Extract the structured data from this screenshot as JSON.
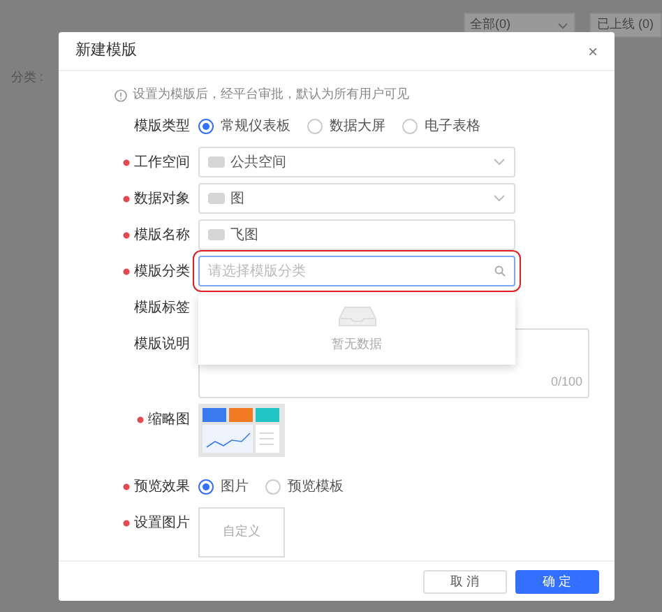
{
  "background": {
    "filter_select": {
      "value": "全部(0)"
    },
    "status_tab": {
      "label": "已上线 (0)"
    },
    "category_label": "分类 :"
  },
  "dialog": {
    "title": "新建模版",
    "close": "×",
    "info": "设置为模版后，经平台审批，默认为所有用户可见",
    "fields": [
      {
        "kind": "radio",
        "label": "模版类型",
        "required": false,
        "options": [
          {
            "label": "常规仪表板",
            "selected": true
          },
          {
            "label": "数据大屏",
            "selected": false
          },
          {
            "label": "电子表格",
            "selected": false
          }
        ]
      },
      {
        "kind": "select",
        "label": "工作空间",
        "required": true,
        "value": "公共空间",
        "highlighted": false
      },
      {
        "kind": "select",
        "label": "数据对象",
        "required": true,
        "value": "图",
        "highlighted": false
      },
      {
        "kind": "input",
        "label": "模版名称",
        "required": true,
        "value": "飞图",
        "highlighted": false
      },
      {
        "kind": "search",
        "label": "模版分类",
        "required": true,
        "placeholder": "请选择模版分类",
        "highlighted": true,
        "empty_text": "暂无数据"
      },
      {
        "kind": "tags",
        "label": "模版标签",
        "required": false
      },
      {
        "kind": "textarea",
        "label": "模版说明",
        "required": false,
        "counter": "0/100"
      },
      {
        "kind": "thumbnail",
        "label": "缩略图",
        "required": true
      },
      {
        "kind": "radio",
        "label": "预览效果",
        "required": true,
        "options": [
          {
            "label": "图片",
            "selected": true
          },
          {
            "label": "预览模板",
            "selected": false
          }
        ]
      },
      {
        "kind": "upload",
        "label": "设置图片",
        "required": true,
        "button": "自定义"
      }
    ],
    "buttons": [
      {
        "label": "取 消",
        "kind": "secondary"
      },
      {
        "label": "确 定",
        "kind": "primary"
      }
    ]
  }
}
